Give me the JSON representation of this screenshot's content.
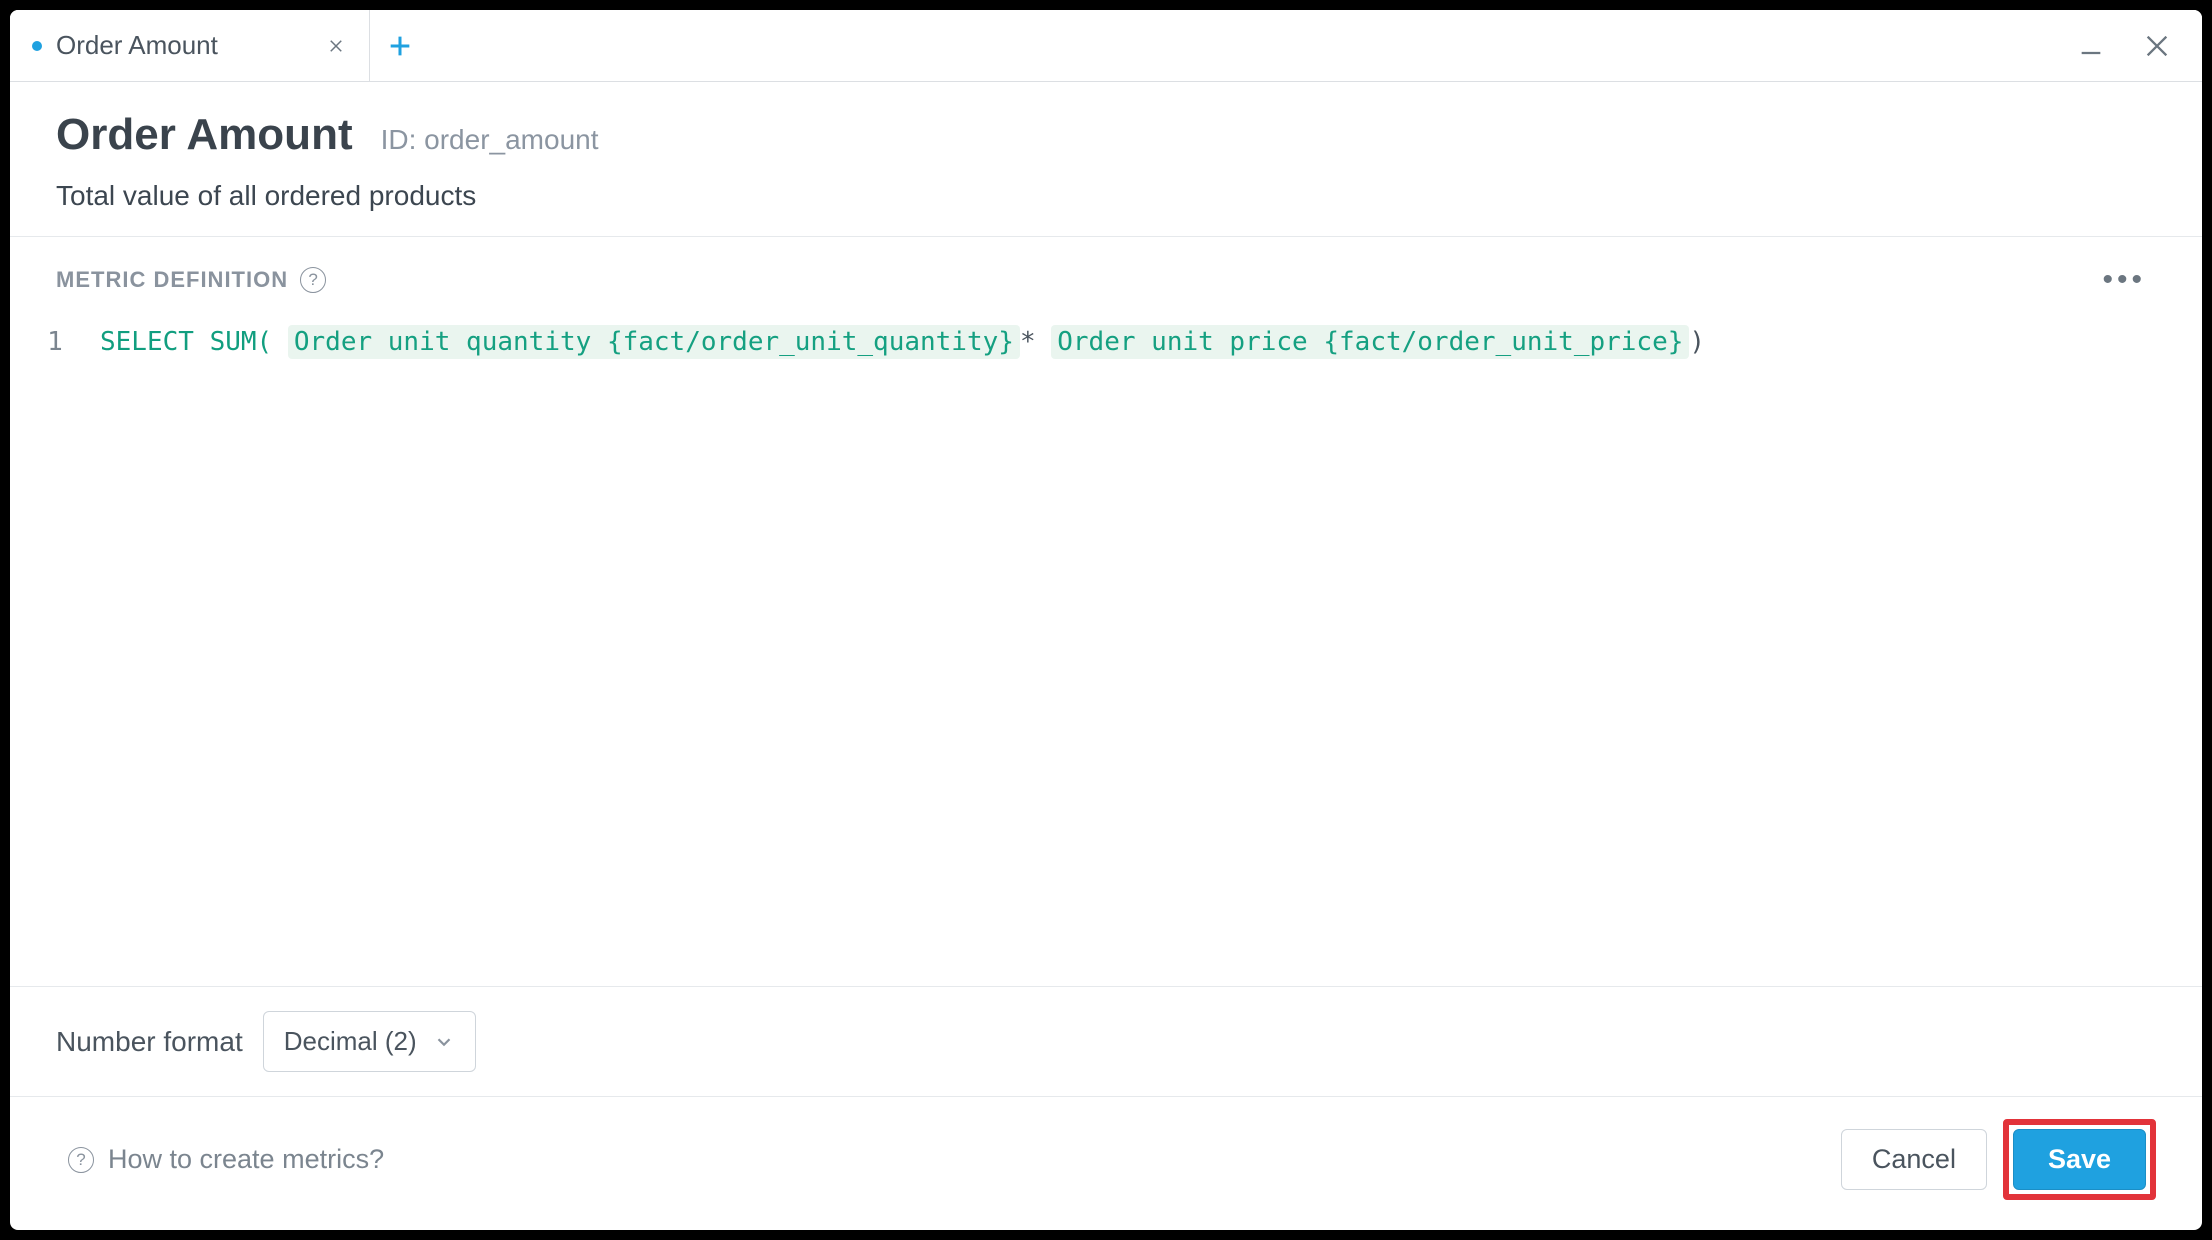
{
  "tab": {
    "title": "Order Amount"
  },
  "header": {
    "title": "Order Amount",
    "id_prefix": "ID:",
    "id_value": "order_amount",
    "description": "Total value of all ordered products"
  },
  "definition": {
    "section_label": "METRIC DEFINITION",
    "line_number": "1",
    "code": {
      "select": "SELECT",
      "sum_open": "SUM(",
      "fact1_name": "Order unit quantity",
      "fact1_path": "{fact/order_unit_quantity}",
      "star": "*",
      "fact2_name": "Order unit price",
      "fact2_path": "{fact/order_unit_price}",
      "close": ")"
    }
  },
  "format": {
    "label": "Number format",
    "selected": "Decimal (2)"
  },
  "footer": {
    "help_link": "How to create metrics?",
    "cancel": "Cancel",
    "save": "Save"
  }
}
